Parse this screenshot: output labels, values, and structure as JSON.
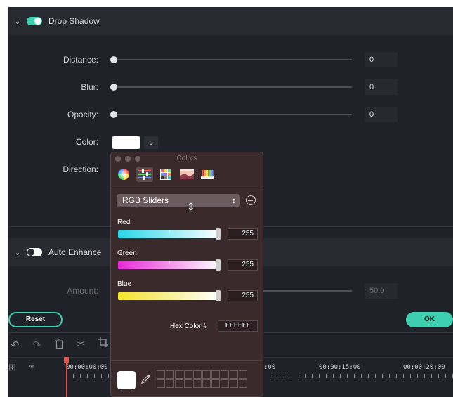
{
  "drop_shadow": {
    "title": "Drop Shadow",
    "enabled": true,
    "distance": {
      "label": "Distance:",
      "value": "0"
    },
    "blur": {
      "label": "Blur:",
      "value": "0"
    },
    "opacity": {
      "label": "Opacity:",
      "value": "0"
    },
    "color": {
      "label": "Color:",
      "value": "#FFFFFF"
    },
    "direction": {
      "label": "Direction:"
    }
  },
  "auto_enhance": {
    "title": "Auto Enhance",
    "enabled": false,
    "amount": {
      "label": "Amount:",
      "value": "50.0"
    }
  },
  "actions": {
    "reset_label": "Reset",
    "ok_label": "OK"
  },
  "timeline": {
    "tools": [
      "undo-icon",
      "redo-icon",
      "trash-icon",
      "scissors-icon",
      "crop-icon"
    ],
    "times": [
      "00:00:00:00",
      ":00",
      "00:00:15:00",
      "00:00:20:00"
    ]
  },
  "colors_panel": {
    "title": "Colors",
    "tabs": [
      "color-wheel-icon",
      "color-sliders-icon",
      "color-palettes-icon",
      "image-palettes-icon",
      "pencils-icon"
    ],
    "active_tab": "color-sliders-icon",
    "mode": "RGB Sliders",
    "channels": [
      {
        "label": "Red",
        "value": "255"
      },
      {
        "label": "Green",
        "value": "255"
      },
      {
        "label": "Blue",
        "value": "255"
      }
    ],
    "hex_label": "Hex Color #",
    "hex_value": "FFFFFF",
    "current_color": "#FFFFFF"
  },
  "colors": {
    "accent": "#3ECFB0",
    "background": "#1F2329",
    "popup_bg": "#3B2A2C"
  }
}
